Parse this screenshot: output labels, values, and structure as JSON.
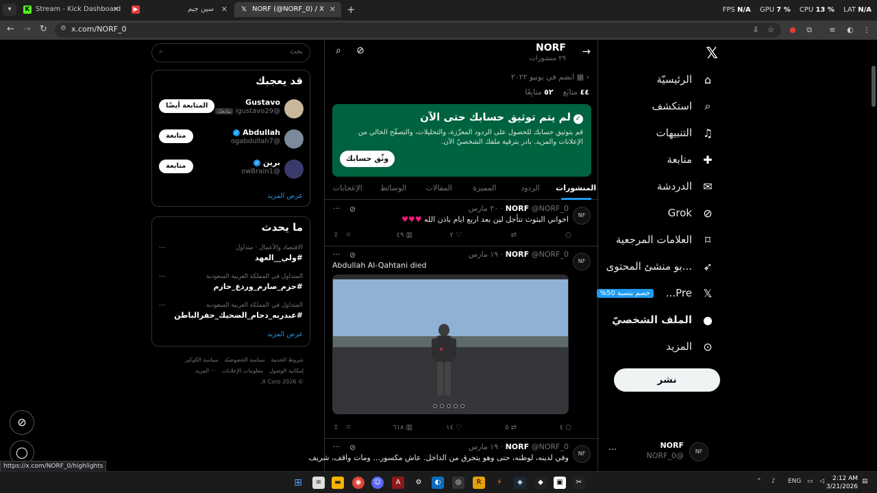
{
  "browser": {
    "tabs": [
      {
        "title": "Stream - Kick Dashboard",
        "favicon": "K",
        "color": "#53fc18",
        "active": false
      },
      {
        "title": "سين جيم",
        "favicon": "▶",
        "color": "#e53935",
        "active": false
      },
      {
        "title": "NORF (@NORF_0) / X",
        "favicon": "X",
        "color": "#ffffff",
        "active": true
      }
    ],
    "perf": {
      "fps_label": "FPS",
      "fps": "N/A",
      "gpu_label": "GPU",
      "gpu": "7 %",
      "cpu_label": "CPU",
      "cpu": "13 %",
      "lat_label": "LAT",
      "lat": "N/A"
    },
    "url": "x.com/NORF_0",
    "status_url": "https://x.com/NORF_0/highlights"
  },
  "nav": {
    "items": [
      {
        "label": "الرئيسيّة",
        "icon": "home-icon"
      },
      {
        "label": "استكشف",
        "icon": "search-icon"
      },
      {
        "label": "التنبيهات",
        "icon": "bell-icon"
      },
      {
        "label": "متابعة",
        "icon": "add-person-icon"
      },
      {
        "label": "الدردشة",
        "icon": "mail-icon"
      },
      {
        "label": "Grok",
        "icon": "grok-icon"
      },
      {
        "label": "العلامات المرجعية",
        "icon": "bookmark-icon"
      },
      {
        "label": "...بو منشئ المحتوى",
        "icon": "rocket-icon"
      },
      {
        "label": "Pre...",
        "icon": "x-icon",
        "badge": "خصم بنسبة 50%"
      },
      {
        "label": "الملف الشخصيّ",
        "icon": "person-icon"
      },
      {
        "label": "المزيد",
        "icon": "more-icon"
      }
    ],
    "post_label": "نشر",
    "account": {
      "name": "NORF",
      "handle": "@NORF_0",
      "avatar": "NF"
    }
  },
  "profile": {
    "name": "NORF",
    "posts_count": "٢٩ منشورات",
    "joined": "انضم في يونيو ٢٠٢٢",
    "following_num": "٤٤",
    "following_label": "متابَع",
    "followers_num": "٥٢",
    "followers_label": "متابِعًا"
  },
  "verify": {
    "title": "لم يتم توثيق حسابك حتى الآن",
    "body": "قم بتوثيق حسابك للحصول على الردود المعزّزة، والتحليلات، والتصفّح الخالي من الإعلانات والمزيد. بادر بترقية ملفك الشخصيّ الآن.",
    "button": "وثّق حسابك"
  },
  "profile_tabs": [
    "المنشورات",
    "الردود",
    "المميزة",
    "المقالات",
    "الوسائط",
    "الإعجابات"
  ],
  "tweets": [
    {
      "name": "NORF",
      "handle": "@NORF_0",
      "date": "٢٠ مارس",
      "text": "اخواني البثوث تتأجل لين بعد اربع ايام باذن الله",
      "hearts": "♥♥♥",
      "replies": "",
      "retweets": "",
      "likes": "٢",
      "views": "٤٩"
    },
    {
      "name": "NORF",
      "handle": "@NORF_0",
      "date": "١٩ مارس",
      "text": "Abdullah Al-Qahtani died",
      "replies": "٤",
      "retweets": "٥",
      "likes": "١٤",
      "views": "٦١٨"
    },
    {
      "name": "NORF",
      "handle": "@NORF_0",
      "date": "١٩ مارس",
      "text": "وفي لدينه، لوطنه، حتى وهو يتحرق من الداخل. عاش مكسور... ومات واقف، شريف"
    }
  ],
  "sidebar": {
    "search_placeholder": "بحث",
    "who_to_follow_title": "قد يعجبك",
    "suggestions": [
      {
        "name": "Gustavo",
        "handle": "@igustavo29",
        "follows_you": "يتابعك",
        "button": "المتابعة أيضًا",
        "verified": false,
        "avatar_color": "#c9b79c"
      },
      {
        "name": "Abdullah",
        "handle": "@ogabdullah7",
        "follows_you": "",
        "button": "متابعة",
        "verified": true,
        "avatar_color": "#7a8a9a"
      },
      {
        "name": "برين",
        "handle": "@owBrain1",
        "follows_you": "",
        "button": "متابعة",
        "verified": true,
        "avatar_color": "#3a3a6a"
      }
    ],
    "show_more": "عرض المزيد",
    "trends_title": "ما يحدث",
    "trends": [
      {
        "category": "الاقتصاد والأعمال · متداول",
        "title": "#ولي__العهد"
      },
      {
        "category": "المتداول في المملكة العربية السعودية",
        "title": "#حزم_صارم_وردع_حازم"
      },
      {
        "category": "المتداول في المملكة العربية السعودية",
        "title": "#عبدربه_دحام_الضحيك_حفرالباطن"
      }
    ],
    "footer_links": [
      "شروط الخدمة",
      "سياسة الخصوصيّة",
      "سياسة الكوكيز",
      "إمكانية الوصول",
      "معلومات الإعلانات",
      "··· المزيد"
    ],
    "copyright": "© 2026 X Corp."
  },
  "taskbar": {
    "lang": "ENG",
    "time": "2:12 AM",
    "date": "3/21/2026"
  },
  "colors": {
    "accent": "#1d9bf0",
    "verify_card": "#006340",
    "like": "#f91880"
  }
}
